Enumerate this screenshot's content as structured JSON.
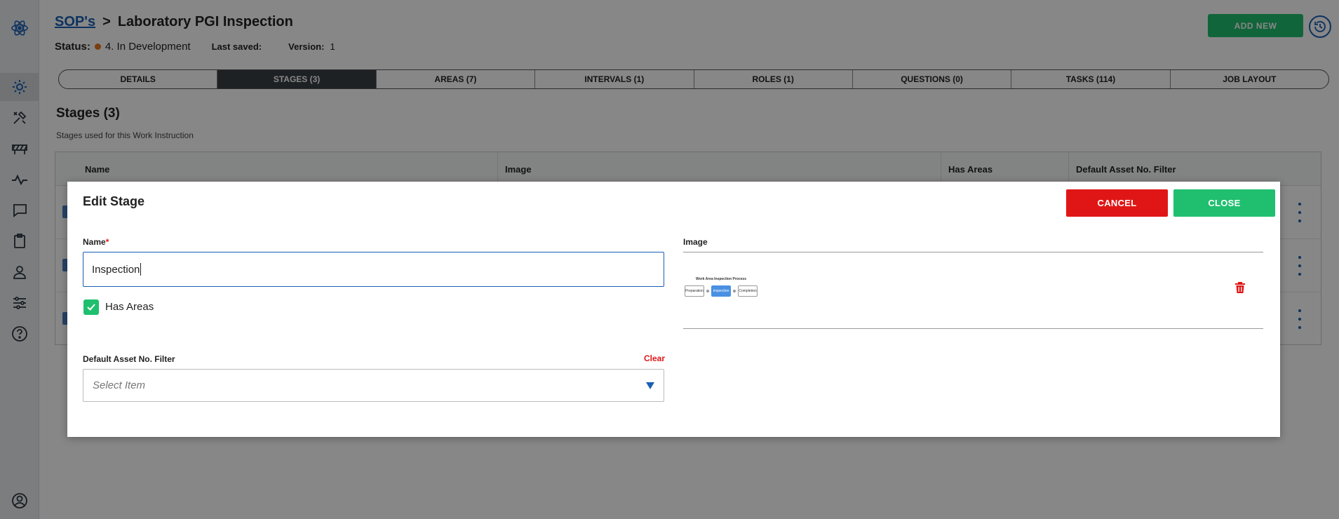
{
  "header": {
    "breadcrumb_link": "SOP's",
    "breadcrumb_sep": ">",
    "title": "Laboratory PGI Inspection",
    "add_new": "ADD NEW"
  },
  "status": {
    "label": "Status:",
    "value": "4. In Development",
    "dot_color": "#e8761c",
    "last_saved_label": "Last saved:",
    "last_saved_value": "",
    "version_label": "Version:",
    "version_value": "1"
  },
  "tabs": [
    {
      "label": "DETAILS",
      "active": false
    },
    {
      "label": "STAGES (3)",
      "active": true
    },
    {
      "label": "AREAS (7)",
      "active": false
    },
    {
      "label": "INTERVALS (1)",
      "active": false
    },
    {
      "label": "ROLES (1)",
      "active": false
    },
    {
      "label": "QUESTIONS (0)",
      "active": false
    },
    {
      "label": "TASKS (114)",
      "active": false
    },
    {
      "label": "JOB LAYOUT",
      "active": false
    }
  ],
  "section": {
    "title": "Stages (3)",
    "subtitle": "Stages used for this Work Instruction"
  },
  "table": {
    "columns": [
      "Name",
      "Image",
      "Has Areas",
      "Default Asset No. Filter"
    ]
  },
  "sidebar": {
    "icons": [
      "atom-logo-icon",
      "settings-gear-icon",
      "tools-icon",
      "road-barrier-icon",
      "activity-icon",
      "chat-icon",
      "clipboard-icon",
      "user-icon",
      "sliders-icon",
      "help-icon",
      "account-icon"
    ]
  },
  "modal": {
    "title": "Edit Stage",
    "cancel": "CANCEL",
    "close": "CLOSE",
    "name_label": "Name",
    "name_required": "*",
    "name_value": "Inspection",
    "has_areas_label": "Has Areas",
    "has_areas_checked": true,
    "filter_label": "Default Asset No. Filter",
    "clear": "Clear",
    "select_placeholder": "Select Item",
    "image_label": "Image",
    "thumbnail": {
      "title": "Work Area Inspection Process",
      "steps": [
        "Preparation",
        "Inspection",
        "Completion"
      ]
    }
  },
  "colors": {
    "accent_blue": "#1a5fb4",
    "green": "#1fbf6f",
    "red": "#e01616"
  }
}
